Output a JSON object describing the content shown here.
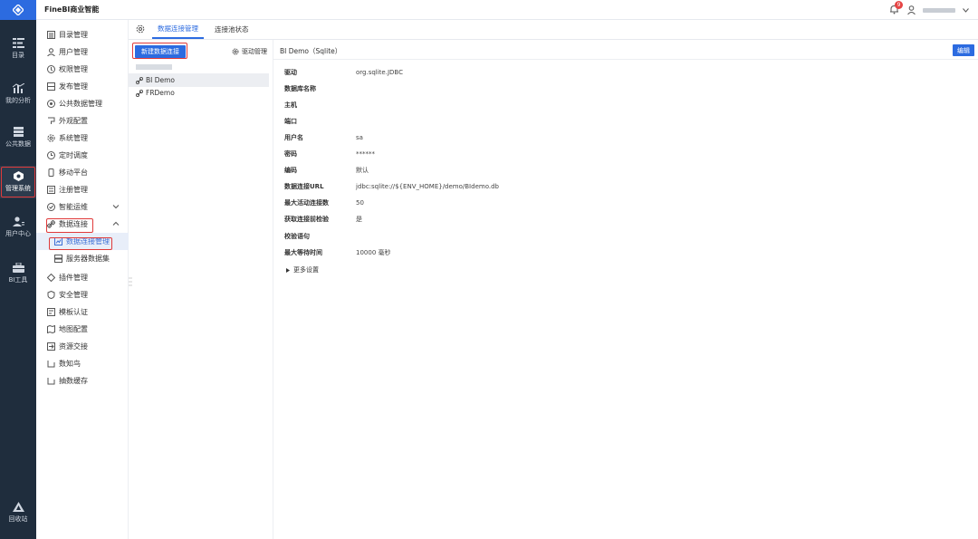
{
  "app": {
    "brand": "FineBI商业智能"
  },
  "colors": {
    "accent": "#2c6be0",
    "rail_bg": "#1f2d3d",
    "highlight": "#e03a3a"
  },
  "header": {
    "notification_count": "9"
  },
  "rail": {
    "items": [
      {
        "label": "目录",
        "icon": "catalog-icon"
      },
      {
        "label": "我的分析",
        "icon": "analysis-icon"
      },
      {
        "label": "公共数据",
        "icon": "public-data-icon"
      },
      {
        "label": "管理系统",
        "icon": "management-icon"
      },
      {
        "label": "用户中心",
        "icon": "user-center-icon"
      },
      {
        "label": "BI工具",
        "icon": "bi-tool-icon"
      },
      {
        "label": "回收站",
        "icon": "recycle-icon"
      }
    ]
  },
  "menu": {
    "items": [
      "目录管理",
      "用户管理",
      "权限管理",
      "发布管理",
      "公共数据管理",
      "外观配置",
      "系统管理",
      "定时调度",
      "移动平台",
      "注册管理",
      "智能运维",
      "数据连接"
    ],
    "subitems": [
      "数据连接管理",
      "服务器数据集"
    ],
    "items_after": [
      "插件管理",
      "安全管理",
      "模板认证",
      "地图配置",
      "资源交接",
      "数知鸟",
      "抽数缓存"
    ]
  },
  "tabs": [
    "数据连接管理",
    "连接池状态"
  ],
  "list": {
    "new_button": "新建数据连接",
    "driver_manage": "驱动管理",
    "connections": [
      "BI Demo",
      "FRDemo"
    ]
  },
  "detail": {
    "title": "BI Demo（Sqlite）",
    "edit_button": "编辑",
    "fields": [
      {
        "label": "驱动",
        "value": "org.sqlite.JDBC"
      },
      {
        "label": "数据库名称",
        "value": ""
      },
      {
        "label": "主机",
        "value": ""
      },
      {
        "label": "端口",
        "value": ""
      },
      {
        "label": "用户名",
        "value": "sa"
      },
      {
        "label": "密码",
        "value": "******"
      },
      {
        "label": "编码",
        "value": "默认"
      },
      {
        "label": "数据连接URL",
        "value": "jdbc:sqlite://${ENV_HOME}/demo/BIdemo.db"
      },
      {
        "label": "最大活动连接数",
        "value": "50"
      },
      {
        "label": "获取连接前检验",
        "value": "是"
      },
      {
        "label": "校验语句",
        "value": ""
      },
      {
        "label": "最大等待时间",
        "value": "10000 毫秒"
      }
    ],
    "more_settings": "更多设置"
  }
}
